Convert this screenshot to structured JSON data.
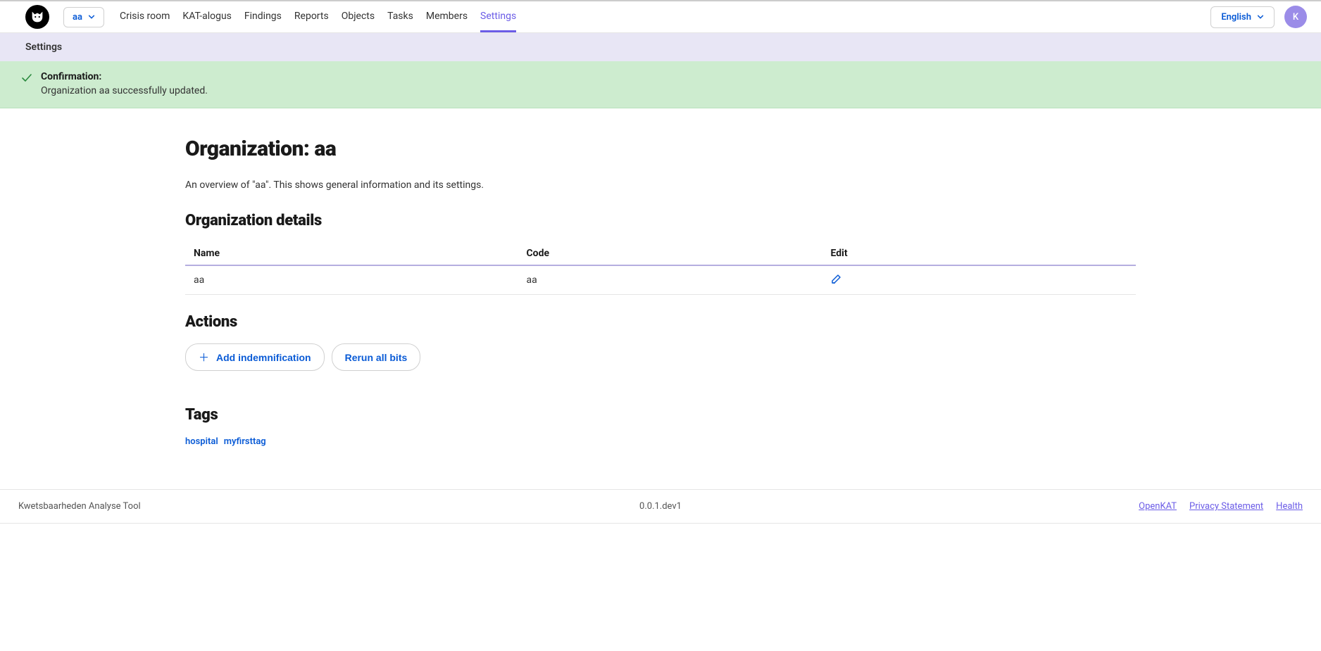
{
  "header": {
    "org_short": "aa",
    "nav": {
      "crisis_room": "Crisis room",
      "kat_alogus": "KAT-alogus",
      "findings": "Findings",
      "reports": "Reports",
      "objects": "Objects",
      "tasks": "Tasks",
      "members": "Members",
      "settings": "Settings"
    },
    "language": "English",
    "avatar_initial": "K"
  },
  "breadcrumb": "Settings",
  "alert": {
    "title": "Confirmation:",
    "message": "Organization aa successfully updated."
  },
  "page": {
    "title": "Organization: aa",
    "subtext": "An overview of \"aa\". This shows general information and its settings."
  },
  "details": {
    "heading": "Organization details",
    "columns": {
      "name": "Name",
      "code": "Code",
      "edit": "Edit"
    },
    "row": {
      "name": "aa",
      "code": "aa"
    }
  },
  "actions": {
    "heading": "Actions",
    "add_indemnification": "Add indemnification",
    "rerun_all_bits": "Rerun all bits"
  },
  "tags": {
    "heading": "Tags",
    "items": [
      "hospital",
      "myfirsttag"
    ]
  },
  "footer": {
    "left": "Kwetsbaarheden Analyse Tool",
    "version": "0.0.1.dev1",
    "links": {
      "openkat": "OpenKAT",
      "privacy": "Privacy Statement",
      "health": "Health"
    }
  }
}
